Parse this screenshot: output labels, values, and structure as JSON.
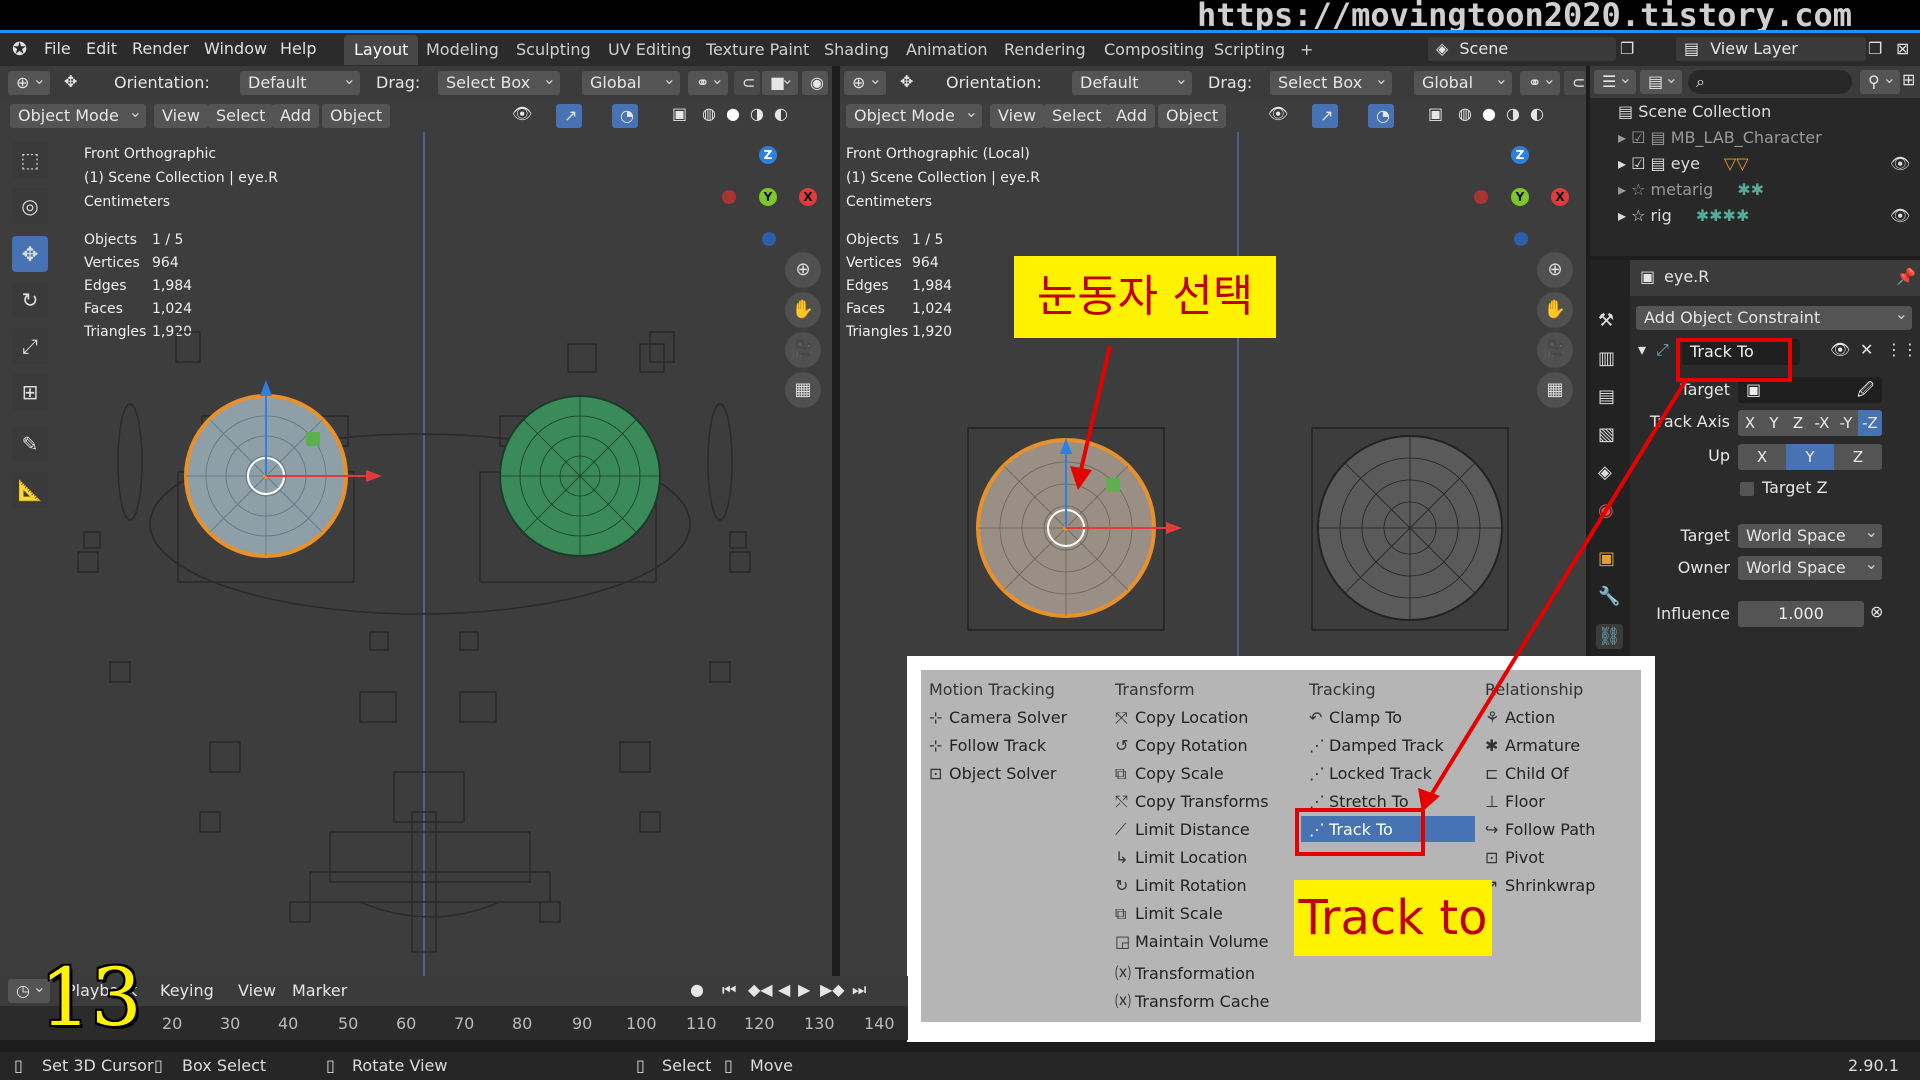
{
  "watermark_url": "https://movingtoon2020.tistory.com",
  "menu": [
    "File",
    "Edit",
    "Render",
    "Window",
    "Help"
  ],
  "workspaces": [
    "Layout",
    "Modeling",
    "Sculpting",
    "UV Editing",
    "Texture Paint",
    "Shading",
    "Animation",
    "Rendering",
    "Compositing",
    "Scripting",
    "+"
  ],
  "scene": "Scene",
  "view_layer": "View Layer",
  "header": {
    "orientation_label": "Orientation:",
    "orientation_value": "Default",
    "drag_label": "Drag:",
    "drag_value": "Select Box",
    "transform_value": "Global"
  },
  "viewport_menu": {
    "mode": "Object Mode",
    "view": "View",
    "select": "Select",
    "add": "Add",
    "object": "Object"
  },
  "left_view": {
    "title": "Front Orthographic",
    "collection": "(1) Scene Collection | eye.R",
    "units": "Centimeters"
  },
  "right_view": {
    "title": "Front Orthographic (Local)",
    "collection": "(1) Scene Collection | eye.R",
    "units": "Centimeters"
  },
  "stats": [
    {
      "k": "Objects",
      "v": "1 / 5"
    },
    {
      "k": "Vertices",
      "v": "964"
    },
    {
      "k": "Edges",
      "v": "1,984"
    },
    {
      "k": "Faces",
      "v": "1,024"
    },
    {
      "k": "Triangles",
      "v": "1,920"
    }
  ],
  "axes": {
    "x": "X",
    "y": "Y",
    "z": "Z"
  },
  "annotation_select": "눈동자 선택",
  "annotation_track": "Track to",
  "step_number": "13",
  "outliner": {
    "root": "Scene Collection",
    "items": [
      "MB_LAB_Character",
      "eye",
      "metarig",
      "rig"
    ]
  },
  "properties": {
    "object_name": "eye.R",
    "add_constraint": "Add Object Constraint",
    "constraint_name": "Track To",
    "target_label": "Target",
    "track_axis_label": "Track Axis",
    "track_axis_options": [
      "X",
      "Y",
      "Z",
      "-X",
      "-Y",
      "-Z"
    ],
    "up_label": "Up",
    "up_options": [
      "X",
      "Y",
      "Z"
    ],
    "target_z": "Target Z",
    "target_space_label": "Target",
    "target_space": "World Space",
    "owner_label": "Owner",
    "owner_space": "World Space",
    "influence_label": "Influence",
    "influence_value": "1.000"
  },
  "constraint_menu": {
    "motion_tracking": {
      "title": "Motion Tracking",
      "items": [
        "Camera Solver",
        "Follow Track",
        "Object Solver"
      ]
    },
    "transform": {
      "title": "Transform",
      "items": [
        "Copy Location",
        "Copy Rotation",
        "Copy Scale",
        "Copy Transforms",
        "Limit Distance",
        "Limit Location",
        "Limit Rotation",
        "Limit Scale",
        "Maintain Volume",
        "Transformation",
        "Transform Cache"
      ]
    },
    "tracking": {
      "title": "Tracking",
      "items": [
        "Clamp To",
        "Damped Track",
        "Locked Track",
        "Stretch To",
        "Track To"
      ]
    },
    "relationship": {
      "title": "Relationship",
      "items": [
        "Action",
        "Armature",
        "Child Of",
        "Floor",
        "Follow Path",
        "Pivot",
        "Shrinkwrap"
      ]
    }
  },
  "timeline": {
    "playback": "Playback",
    "keying": "Keying",
    "view": "View",
    "marker": "Marker",
    "ticks": [
      "20",
      "30",
      "40",
      "50",
      "60",
      "70",
      "80",
      "90",
      "100",
      "110",
      "120",
      "130",
      "140"
    ]
  },
  "statusbar": {
    "set_cursor": "Set 3D Cursor",
    "box_select": "Box Select",
    "rotate_view": "Rotate View",
    "select": "Select",
    "move": "Move",
    "version": "2.90.1"
  },
  "colors": {
    "accent": "#4772b3",
    "annotation_bg": "#fff200",
    "annotation_text": "#c00000",
    "highlight_box": "#e60000",
    "eye_selected": "#e8902a",
    "eye_green": "#3a8a5a"
  }
}
